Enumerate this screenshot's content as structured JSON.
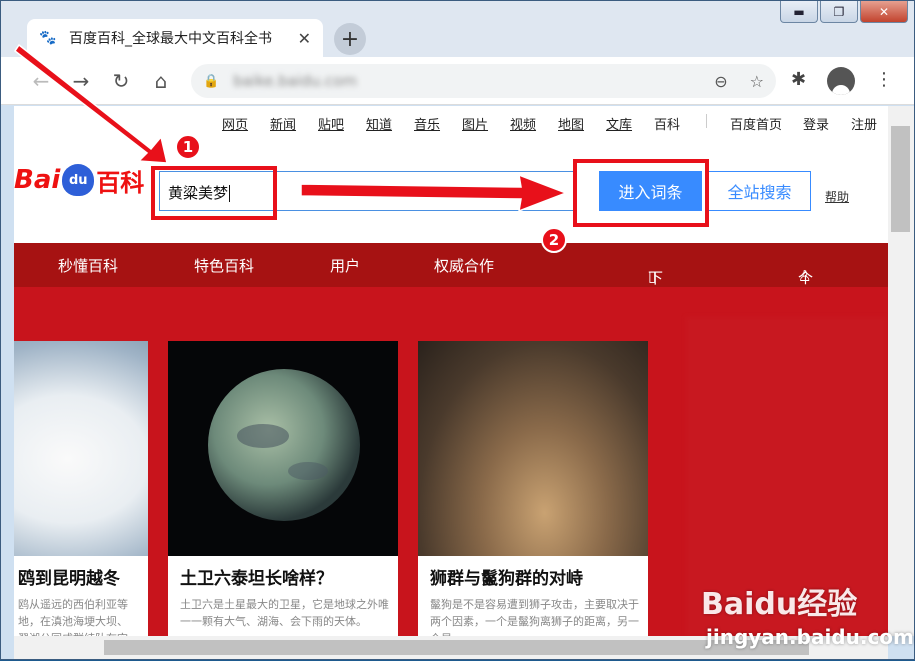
{
  "browser": {
    "tab_title": "百度百科_全球最大中文百科全书",
    "tab_favicon": "baidu-paw-icon",
    "new_tab_label": "+",
    "url": "baike.baidu.com",
    "window_controls": {
      "minimize": "▬",
      "maximize": "❐",
      "close": "✕"
    }
  },
  "topnav": {
    "links": [
      "网页",
      "新闻",
      "贴吧",
      "知道",
      "音乐",
      "图片",
      "视频",
      "地图",
      "文库",
      "百科"
    ],
    "right_links": [
      "百度首页",
      "登录",
      "注册"
    ]
  },
  "logo": {
    "bai": "Bai",
    "du": "du",
    "baike": "百科"
  },
  "search": {
    "value": "黄粱美梦",
    "enter_button": "进入词条",
    "site_button": "全站搜索",
    "help": "帮助"
  },
  "rednav": {
    "items": [
      "秒懂百科",
      "特色百科",
      "用户",
      "权威合作"
    ],
    "app": "下载百科APP",
    "user_center": "个人中心"
  },
  "cards": [
    {
      "title": "鸥到昆明越冬",
      "desc": "鸥从遥远的西伯利亚等地，在滇池海埂大坝、翠湖公园成群结队在空中"
    },
    {
      "title": "土卫六泰坦长啥样？",
      "desc": "土卫六是土星最大的卫星，它是地球之外唯一一颗有大气、湖海、会下雨的天体。"
    },
    {
      "title": "狮群与鬣狗群的对峙",
      "desc": "鬣狗是不是容易遭到狮子攻击，主要取决于两个因素，一个是鬣狗离狮子的距离，另一个是"
    }
  ],
  "annotations": {
    "step1": "1",
    "step2": "2"
  },
  "watermark": {
    "main": "Baidu经验",
    "sub": "jingyan.baidu.com"
  },
  "colors": {
    "accent": "#388bff",
    "red_nav": "#a61212",
    "banner": "#c8141c",
    "annotation": "#e8101a"
  }
}
